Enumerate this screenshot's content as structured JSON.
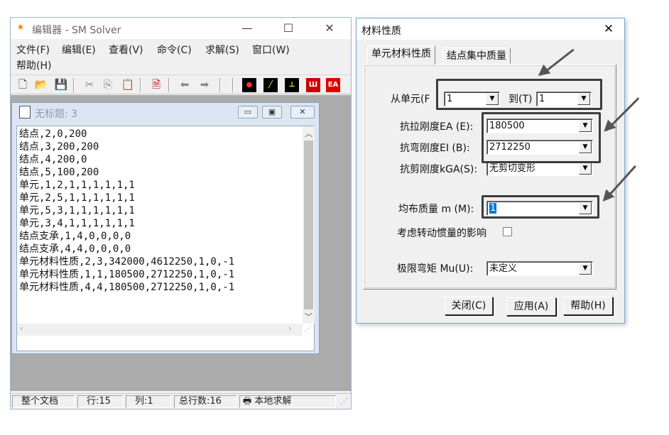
{
  "editor": {
    "title": "编辑器 - SM Solver",
    "caption": {
      "min": "—",
      "max": "☐",
      "close": "✕"
    },
    "menu": [
      "文件(F)",
      "编辑(E)",
      "查看(V)",
      "命令(C)",
      "求解(S)",
      "窗口(W)",
      "帮助(H)"
    ],
    "toolbar_red": [
      "EA"
    ],
    "child": {
      "title": "无标题: 3",
      "lines": [
        "结点,2,0,200",
        "结点,3,200,200",
        "结点,4,200,0",
        "结点,5,100,200",
        "单元,1,2,1,1,1,1,1,1",
        "单元,2,5,1,1,1,1,1,1",
        "单元,5,3,1,1,1,1,1,1",
        "单元,3,4,1,1,1,1,1,1",
        "结点支承,1,4,0,0,0,0",
        "结点支承,4,4,0,0,0,0",
        "单元材料性质,2,3,342000,4612250,1,0,-1",
        "单元材料性质,1,1,180500,2712250,1,0,-1",
        "单元材料性质,4,4,180500,2712250,1,0,-1"
      ]
    },
    "status": [
      "整个文档",
      "行:15",
      "列:1",
      "总行数:16",
      "本地求解"
    ]
  },
  "dialog": {
    "title": "材料性质",
    "close": "✕",
    "tabs": [
      "单元材料性质",
      "结点集中质量"
    ],
    "from_label": "从单元(F",
    "from_value": "1",
    "to_label": "到(T)",
    "to_value": "1",
    "ea_label": "抗拉刚度EA (E):",
    "ea_value": "180500",
    "ei_label": "抗弯刚度EI (B):",
    "ei_value": "2712250",
    "kga_label": "抗剪刚度kGA(S):",
    "kga_value": "无剪切变形",
    "mass_label": "均布质量 m (M):",
    "mass_value": "1",
    "rot_label": "考虑转动惯量的影响",
    "mu_label": "极限弯矩 Mu(U):",
    "mu_value": "未定义",
    "btn_close": "关闭(C)",
    "btn_apply": "应用(A)",
    "btn_help": "帮助(H)"
  }
}
